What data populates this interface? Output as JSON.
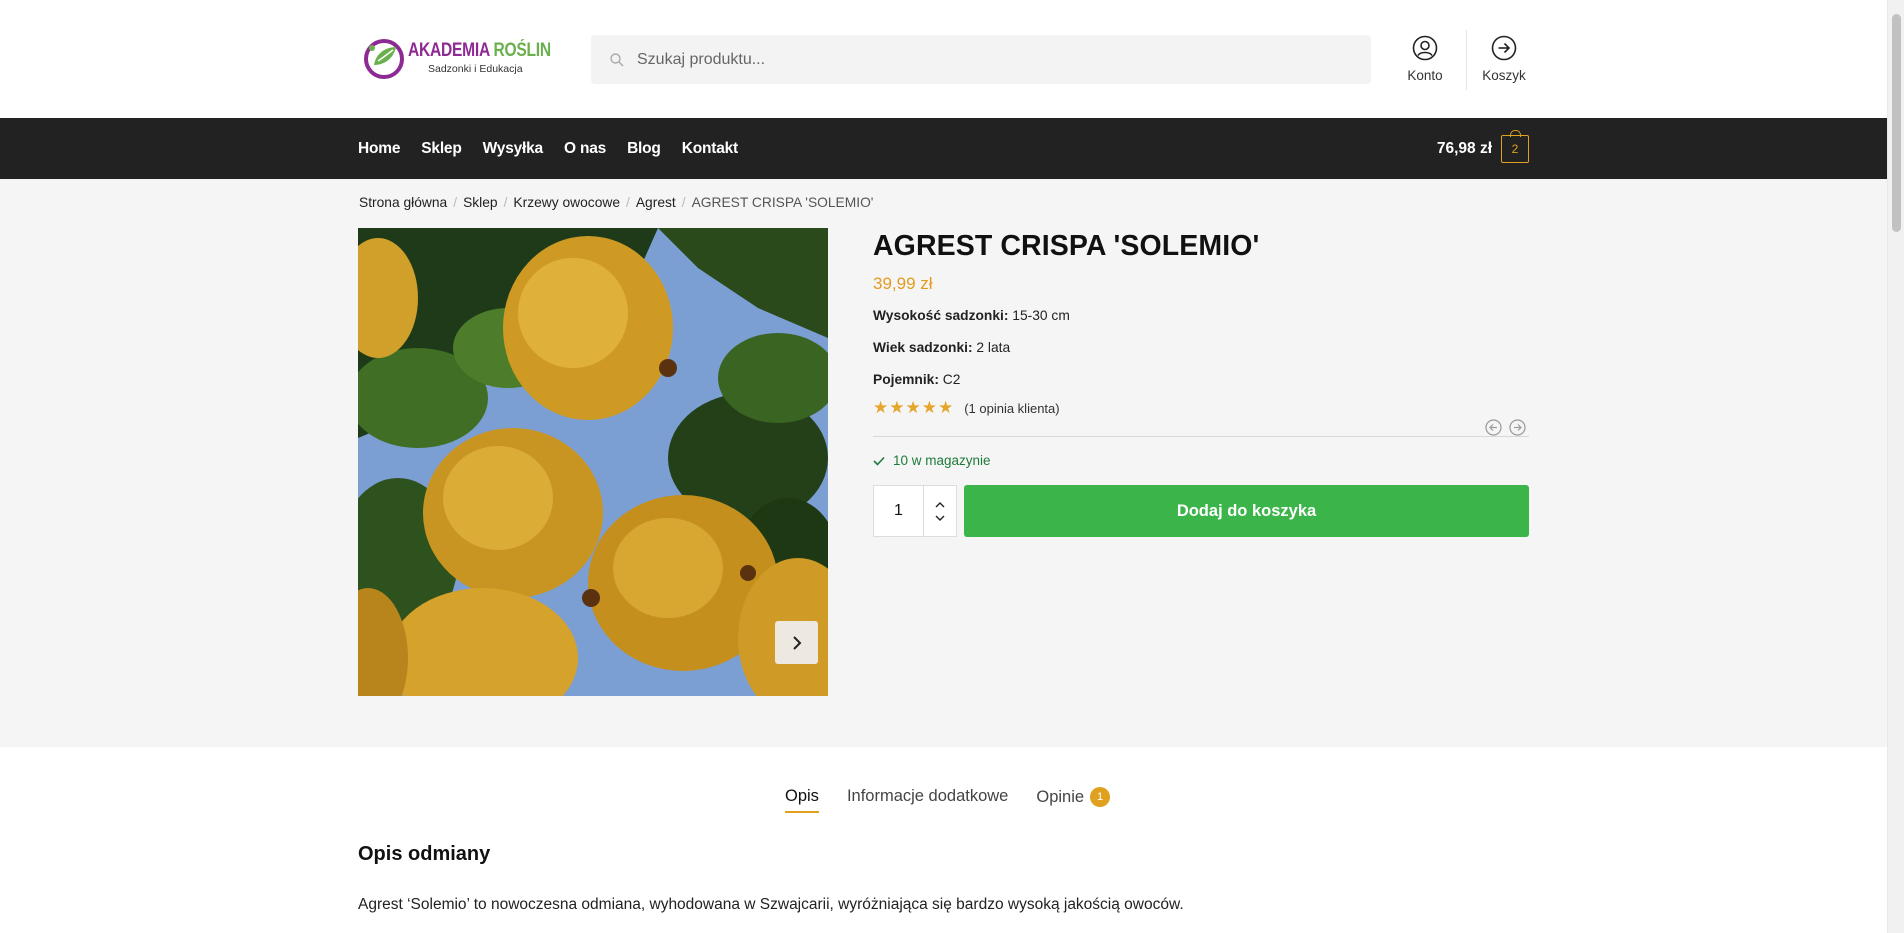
{
  "logo": {
    "title_part1": "AKADEMIA ",
    "title_part2": "ROŚLIN",
    "subtitle": "Sadzonki i Edukacja"
  },
  "search": {
    "placeholder": "Szukaj produktu..."
  },
  "header": {
    "account_label": "Konto",
    "cart_label": "Koszyk"
  },
  "nav": {
    "items": [
      "Home",
      "Sklep",
      "Wysyłka",
      "O nas",
      "Blog",
      "Kontakt"
    ],
    "cart_total": "76,98 zł",
    "cart_count": "2"
  },
  "breadcrumb": {
    "items": [
      "Strona główna",
      "Sklep",
      "Krzewy owocowe",
      "Agrest"
    ],
    "current": "AGREST CRISPA 'SOLEMIO'"
  },
  "product": {
    "title": "AGREST CRISPA 'SOLEMIO'",
    "price": "39,99 zł",
    "attributes": [
      {
        "label": "Wysokość sadzonki:",
        "value": " 15-30 cm"
      },
      {
        "label": "Wiek sadzonki:",
        "value": " 2 lata"
      },
      {
        "label": "Pojemnik:",
        "value": " C2"
      }
    ],
    "rating_stars": 5,
    "rating_link": "(1 opinia klienta)",
    "stock": "10 w magazynie",
    "quantity": "1",
    "add_to_cart": "Dodaj do koszyka"
  },
  "tabs": {
    "items": [
      "Opis",
      "Informacje dodatkowe",
      "Opinie"
    ],
    "reviews_count": "1",
    "active": "Opis"
  },
  "description": {
    "title": "Opis odmiany",
    "text": "Agrest ‘Solemio’ to nowoczesna odmiana, wyhodowana w Szwajcarii, wyróżniająca się bardzo wysoką jakością owoców."
  },
  "colors": {
    "accent": "#e0a020",
    "button": "#3bb44a",
    "nav_bg": "#222222",
    "stock": "#1e7a3a"
  }
}
